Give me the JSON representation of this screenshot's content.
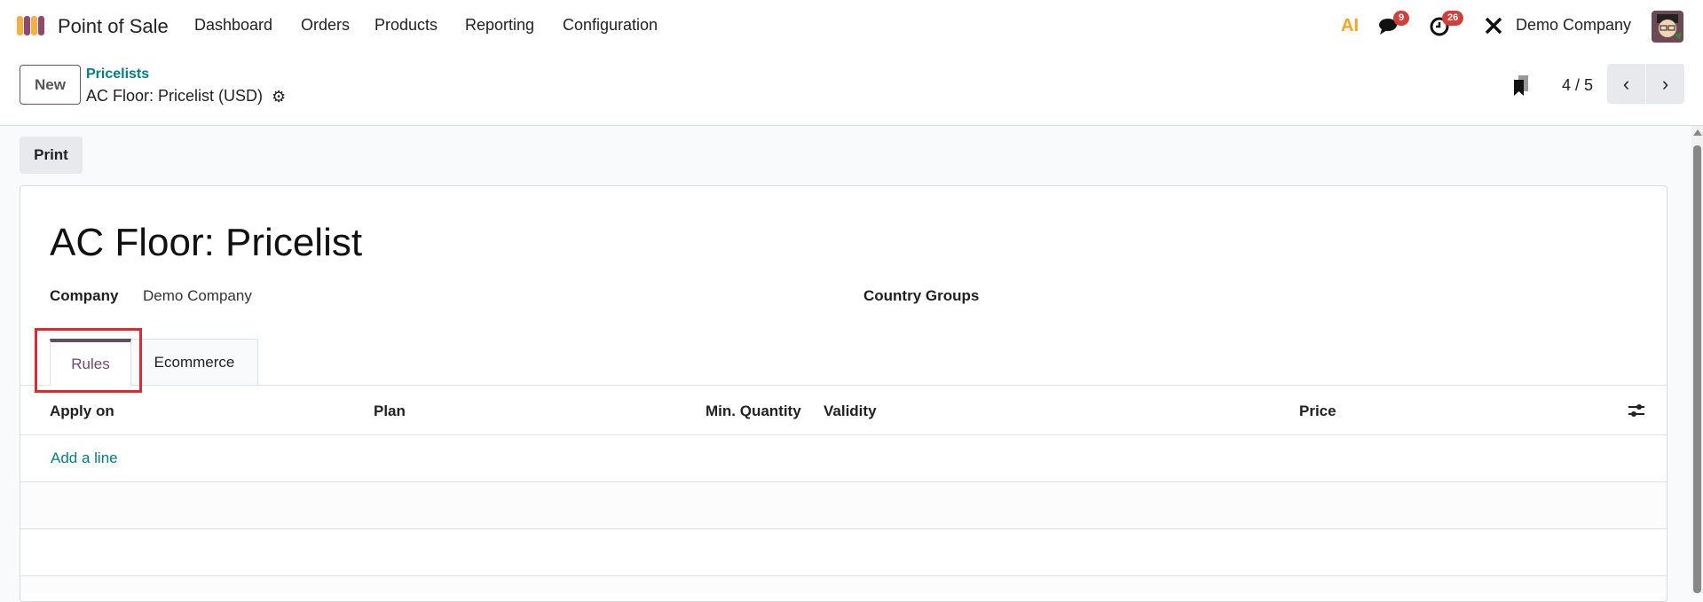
{
  "navbar": {
    "app_name": "Point of Sale",
    "menu": [
      "Dashboard",
      "Orders",
      "Products",
      "Reporting",
      "Configuration"
    ],
    "ai_label": "AI",
    "messages_count": "9",
    "activities_count": "26",
    "company": "Demo Company"
  },
  "control_panel": {
    "new_label": "New",
    "breadcrumb_parent": "Pricelists",
    "record_name": "AC Floor: Pricelist (USD)",
    "pager": "4 / 5"
  },
  "actions": {
    "print_label": "Print"
  },
  "form": {
    "title": "AC Floor: Pricelist",
    "company_label": "Company",
    "company_value": "Demo Company",
    "country_groups_label": "Country Groups",
    "tabs": [
      {
        "label": "Rules",
        "active": true
      },
      {
        "label": "Ecommerce",
        "active": false
      }
    ],
    "columns": [
      "Apply on",
      "Plan",
      "Min. Quantity",
      "Validity",
      "Price"
    ],
    "add_line": "Add a line"
  },
  "colors": {
    "accent": "#714b67",
    "link": "#017e84",
    "highlight": "#e0282e"
  }
}
